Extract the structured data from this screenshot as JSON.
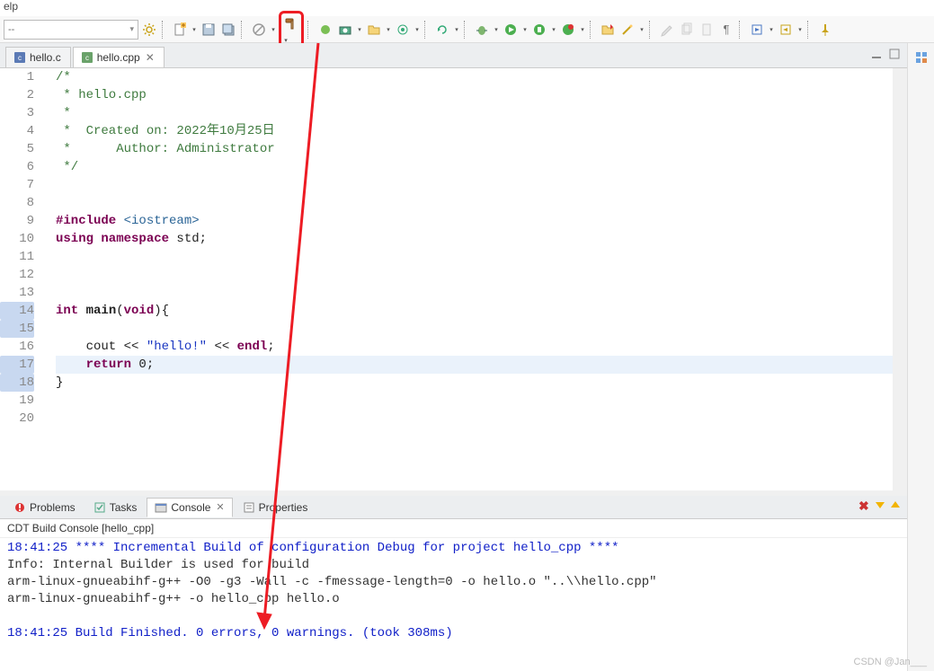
{
  "menu_partial": "elp",
  "toolbar": {
    "selector_value": "--"
  },
  "editor_tabs": [
    {
      "label": "hello.c",
      "active": false,
      "closable": false,
      "icon": "c"
    },
    {
      "label": "hello.cpp",
      "active": true,
      "closable": true,
      "icon": "cpp"
    }
  ],
  "code": {
    "lines": [
      {
        "n": 1,
        "cls": "",
        "html": [
          {
            "t": "/*",
            "c": "c-comment"
          }
        ]
      },
      {
        "n": 2,
        "cls": "",
        "html": [
          {
            "t": " * hello.cpp",
            "c": "c-comment"
          }
        ]
      },
      {
        "n": 3,
        "cls": "",
        "html": [
          {
            "t": " *",
            "c": "c-comment"
          }
        ]
      },
      {
        "n": 4,
        "cls": "",
        "html": [
          {
            "t": " *  Created on: 2022年10月25日",
            "c": "c-comment"
          }
        ]
      },
      {
        "n": 5,
        "cls": "",
        "html": [
          {
            "t": " *      Author: Administrator",
            "c": "c-comment"
          }
        ]
      },
      {
        "n": 6,
        "cls": "",
        "html": [
          {
            "t": " */",
            "c": "c-comment"
          }
        ]
      },
      {
        "n": 7,
        "cls": "",
        "html": []
      },
      {
        "n": 8,
        "cls": "",
        "html": []
      },
      {
        "n": 9,
        "cls": "",
        "html": [
          {
            "t": "#include ",
            "c": "c-pp"
          },
          {
            "t": "<iostream>",
            "c": "c-pp-inc"
          }
        ]
      },
      {
        "n": 10,
        "cls": "",
        "html": [
          {
            "t": "using namespace ",
            "c": "c-keyword"
          },
          {
            "t": "std;",
            "c": ""
          }
        ]
      },
      {
        "n": 11,
        "cls": "",
        "html": []
      },
      {
        "n": 12,
        "cls": "",
        "html": []
      },
      {
        "n": 13,
        "cls": "",
        "html": []
      },
      {
        "n": 14,
        "cls": "",
        "break": true,
        "html": [
          {
            "t": "int ",
            "c": "c-keyword"
          },
          {
            "t": "main",
            "c": "c-func"
          },
          {
            "t": "(",
            "c": ""
          },
          {
            "t": "void",
            "c": "c-keyword"
          },
          {
            "t": "){",
            "c": ""
          }
        ]
      },
      {
        "n": 15,
        "cls": "",
        "break": true,
        "html": []
      },
      {
        "n": 16,
        "cls": "",
        "html": [
          {
            "t": "    cout << ",
            "c": ""
          },
          {
            "t": "\"hello!\"",
            "c": "c-string"
          },
          {
            "t": " << ",
            "c": ""
          },
          {
            "t": "endl",
            "c": "c-keyword"
          },
          {
            "t": ";",
            "c": ""
          }
        ]
      },
      {
        "n": 17,
        "cls": "hl",
        "break": true,
        "html": [
          {
            "t": "    ",
            "c": ""
          },
          {
            "t": "return",
            "c": "c-keyword"
          },
          {
            "t": " 0;",
            "c": ""
          }
        ]
      },
      {
        "n": 18,
        "cls": "",
        "break": true,
        "html": [
          {
            "t": "}",
            "c": ""
          }
        ]
      },
      {
        "n": 19,
        "cls": "",
        "html": []
      },
      {
        "n": 20,
        "cls": "",
        "html": []
      }
    ]
  },
  "bottom_tabs": [
    {
      "label": "Problems",
      "icon": "problems"
    },
    {
      "label": "Tasks",
      "icon": "tasks"
    },
    {
      "label": "Console",
      "icon": "console",
      "active": true,
      "closable": true
    },
    {
      "label": "Properties",
      "icon": "properties"
    }
  ],
  "console": {
    "title": "CDT Build Console [hello_cpp]",
    "lines": [
      {
        "text": "18:41:25 **** Incremental Build of configuration Debug for project hello_cpp ****",
        "c": "co-blue"
      },
      {
        "text": "Info: Internal Builder is used for build",
        "c": ""
      },
      {
        "text": "arm-linux-gnueabihf-g++ -O0 -g3 -Wall -c -fmessage-length=0 -o hello.o \"..\\\\hello.cpp\"",
        "c": ""
      },
      {
        "text": "arm-linux-gnueabihf-g++ -o hello_cpp hello.o",
        "c": ""
      },
      {
        "text": "",
        "c": ""
      },
      {
        "text": "18:41:25 Build Finished. 0 errors, 0 warnings. (took 308ms)",
        "c": "co-blue"
      }
    ]
  },
  "watermark": "CSDN @Jan___"
}
